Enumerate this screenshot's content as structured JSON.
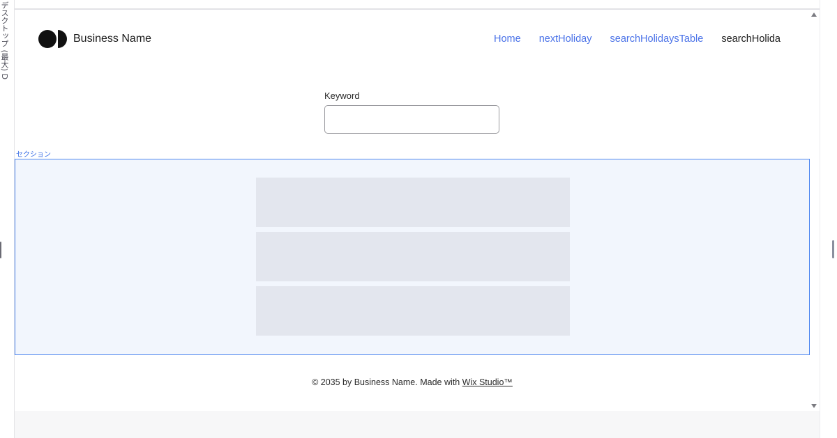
{
  "editor": {
    "left_vertical_label": "デスクトップ (最大) D",
    "section_tag": "セクション"
  },
  "header": {
    "brand_name": "Business Name",
    "nav": [
      {
        "label": "Home"
      },
      {
        "label": "nextHoliday"
      },
      {
        "label": "searchHolidaysTable"
      },
      {
        "label": "searchHolida"
      }
    ]
  },
  "search": {
    "label": "Keyword",
    "value": "",
    "placeholder": ""
  },
  "footer": {
    "text": "© 2035 by Business Name. Made with ",
    "link": "Wix Studio™"
  },
  "colors": {
    "link": "#4a72e8",
    "section_border": "#4d86f0",
    "section_bg": "#f2f6fd",
    "placeholder_block": "#e3e6ee"
  }
}
